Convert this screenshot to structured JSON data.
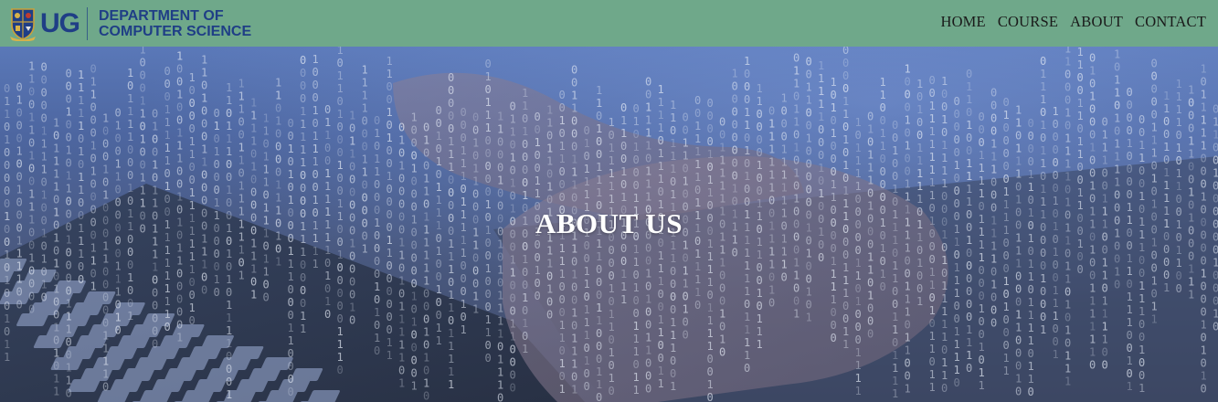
{
  "header": {
    "logo_abbr": "UG",
    "dept_line1": "DEPARTMENT OF",
    "dept_line2": "COMPUTER SCIENCE",
    "logo_icon": "university-crest-icon"
  },
  "nav": {
    "items": [
      {
        "label": "HOME"
      },
      {
        "label": "COURSE"
      },
      {
        "label": "ABOUT"
      },
      {
        "label": "CONTACT"
      }
    ]
  },
  "hero": {
    "title": "ABOUT US",
    "background": "binary-code-keyboard-image"
  },
  "colors": {
    "navbar_bg": "#6fa88a",
    "brand_blue": "#1f3e86",
    "hero_title": "#ffffff"
  }
}
